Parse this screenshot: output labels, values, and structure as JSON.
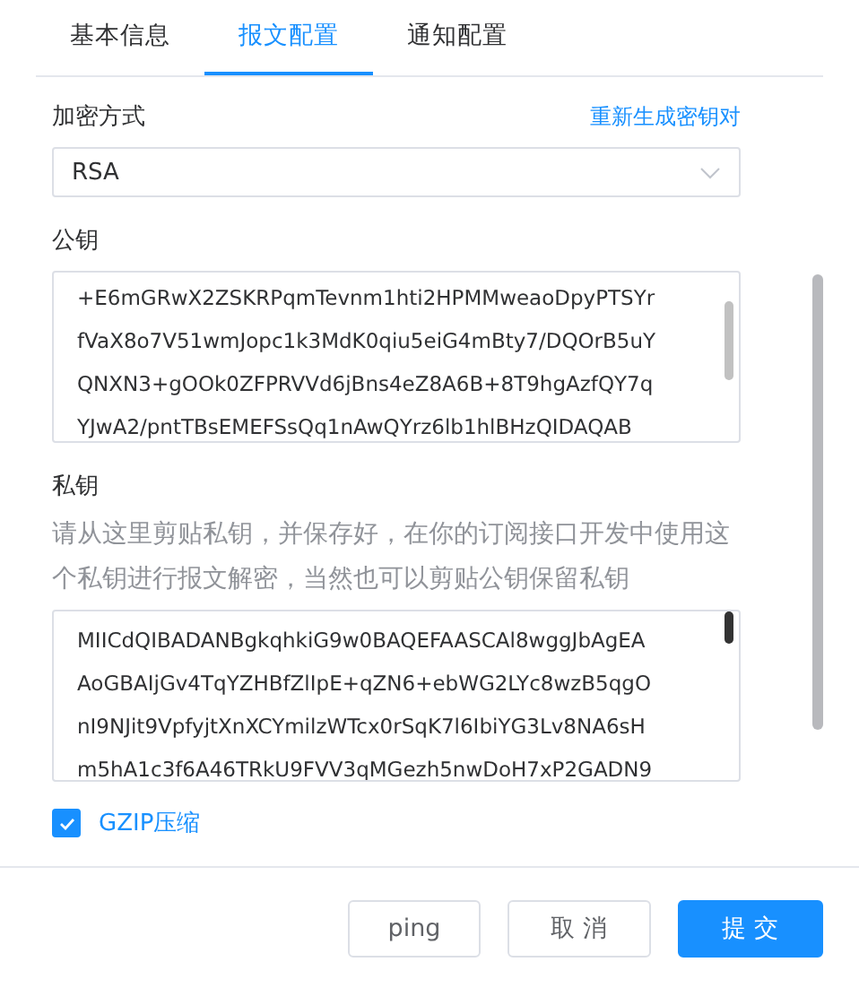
{
  "tabs": [
    {
      "label": "基本信息",
      "selected": false
    },
    {
      "label": "报文配置",
      "selected": true
    },
    {
      "label": "通知配置",
      "selected": false
    }
  ],
  "encryption": {
    "label": "加密方式",
    "action": "重新生成密钥对",
    "value": "RSA"
  },
  "public_key": {
    "label": "公钥",
    "lines": [
      "+E6mGRwX2ZSKRPqmTevnm1hti2HPMMweaoDpyPTSYr",
      "fVaX8o7V51wmJopc1k3MdK0qiu5eiG4mBty7/DQOrB5uY",
      "QNXN3+gOOk0ZFPRVVd6jBns4eZ8A6B+8T9hgAzfQY7q",
      "YJwA2/pntTBsEMEFSsQq1nAwQYrz6lb1hlBHzQIDAQAB"
    ]
  },
  "private_key": {
    "label": "私钥",
    "description": "请从这里剪贴私钥，并保存好，在你的订阅接口开发中使用这个私钥进行报文解密，当然也可以剪贴公钥保留私钥",
    "lines": [
      "MIICdQIBADANBgkqhkiG9w0BAQEFAASCAl8wggJbAgEA",
      "AoGBAIjGv4TqYZHBfZlIpE+qZN6+ebWG2LYc8wzB5qgO",
      "nI9NJit9VpfyjtXnXCYmilzWTcx0rSqK7l6IbiYG3Lv8NA6sH",
      "m5hA1c3f6A46TRkU9FVV3qMGezh5nwDoH7xP2GADN9"
    ]
  },
  "gzip": {
    "label": "GZIP压缩",
    "checked": true
  },
  "buttons": [
    {
      "label": "ping",
      "kind": "default"
    },
    {
      "label": "取 消",
      "kind": "default"
    },
    {
      "label": "提 交",
      "kind": "primary"
    }
  ]
}
